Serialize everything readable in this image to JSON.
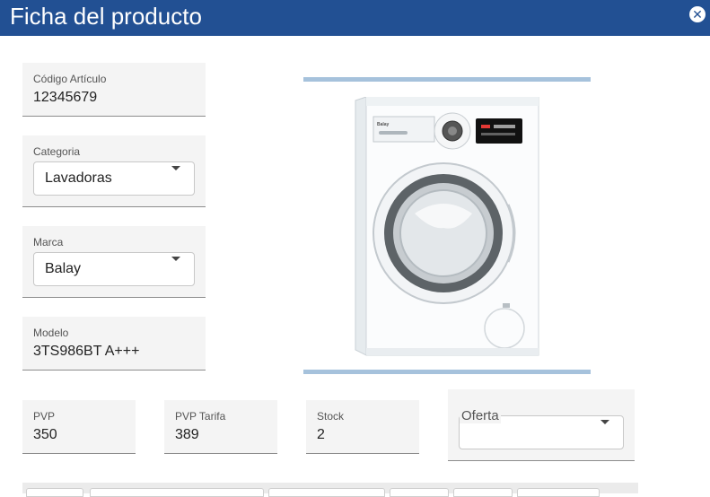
{
  "window": {
    "title": "Ficha del producto",
    "close_icon": "close-circle-icon"
  },
  "form": {
    "codigo": {
      "label": "Código Artículo",
      "value": "12345679"
    },
    "categoria": {
      "label": "Categoria",
      "value": "Lavadoras"
    },
    "marca": {
      "label": "Marca",
      "value": "Balay"
    },
    "modelo": {
      "label": "Modelo",
      "value": "3TS986BT A+++"
    },
    "pvp": {
      "label": "PVP",
      "value": "350"
    },
    "pvp_tarifa": {
      "label": "PVP Tarifa",
      "value": "389"
    },
    "stock": {
      "label": "Stock",
      "value": "2"
    },
    "oferta": {
      "label": "Oferta",
      "value": ""
    }
  },
  "product_image": {
    "subject": "washing-machine-icon",
    "brand_badge": "Balay"
  },
  "colors": {
    "title_bar": "#225093",
    "field_bg": "#f4f4f4",
    "image_frame_line": "#a6c2dc"
  }
}
